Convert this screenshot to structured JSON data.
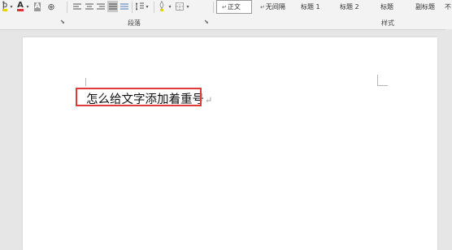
{
  "ribbon": {
    "font_tools": [
      {
        "name": "highlight",
        "glyph": "ꝥ"
      },
      {
        "name": "font-color",
        "glyph": "A"
      },
      {
        "name": "char-shading",
        "glyph": "A"
      },
      {
        "name": "enclose-char",
        "glyph": "⊕"
      }
    ],
    "paragraph_group_label": "段落",
    "styles_group_label": "样式",
    "styles": [
      {
        "label": "正文",
        "mark": "↵"
      },
      {
        "label": "无间隔",
        "mark": "↵"
      },
      {
        "label": "标题 1"
      },
      {
        "label": "标题 2"
      },
      {
        "label": "标题"
      },
      {
        "label": "副标题"
      },
      {
        "label": "不"
      }
    ]
  },
  "document": {
    "text": "怎么给文字添加着重号",
    "paragraph_mark": "↵"
  },
  "colors": {
    "highlight_border": "#e03a3a",
    "font_color_accent": "#d33",
    "highlight_accent": "#e8d400"
  }
}
